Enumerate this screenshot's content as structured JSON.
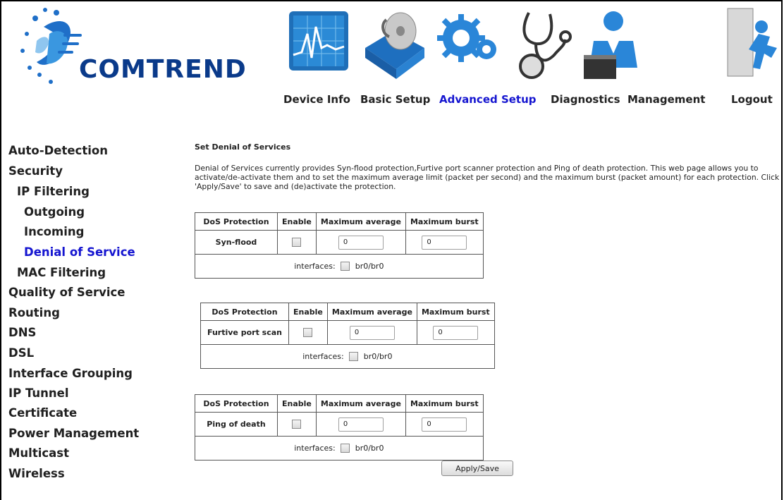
{
  "header": {
    "brand": "COMTREND",
    "nav": [
      {
        "label": "Device Info",
        "icon": "chart-icon"
      },
      {
        "label": "Basic Setup",
        "icon": "disc-icon"
      },
      {
        "label": "Advanced Setup",
        "icon": "gear-icon"
      },
      {
        "label": "Diagnostics",
        "icon": "stethoscope-icon"
      },
      {
        "label": "Management",
        "icon": "user-icon"
      },
      {
        "label": "Logout",
        "icon": "exit-icon"
      }
    ],
    "active_index": 2
  },
  "sidebar": {
    "items": [
      {
        "label": "Auto-Detection"
      },
      {
        "label": "Security"
      },
      {
        "label": "IP Filtering"
      },
      {
        "label": "Outgoing"
      },
      {
        "label": "Incoming"
      },
      {
        "label": "Denial of Service"
      },
      {
        "label": "MAC Filtering"
      },
      {
        "label": "Quality of Service"
      },
      {
        "label": "Routing"
      },
      {
        "label": "DNS"
      },
      {
        "label": "DSL"
      },
      {
        "label": "Interface Grouping"
      },
      {
        "label": "IP Tunnel"
      },
      {
        "label": "Certificate"
      },
      {
        "label": "Power Management"
      },
      {
        "label": "Multicast"
      },
      {
        "label": "Wireless"
      }
    ],
    "active_index": 5
  },
  "main": {
    "title": "Set Denial of Services",
    "description": "Denial of Services currently provides Syn-flood protection,Furtive port scanner protection and Ping of death protection. This web page allows you to activate/de-activate them and to set the maximum average limit (packet per second) and the maximum burst (packet amount) for each protection. Click 'Apply/Save' to save and (de)activate the protection.",
    "columns": {
      "protection": "DoS Protection",
      "enable": "Enable",
      "avg": "Maximum average",
      "burst": "Maximum burst"
    },
    "tables": [
      {
        "name": "Syn-flood",
        "enabled": false,
        "max_average": "0",
        "max_burst": "0",
        "interfaces_label": "interfaces:",
        "interface": "br0/br0"
      },
      {
        "name": "Furtive port scan",
        "enabled": false,
        "max_average": "0",
        "max_burst": "0",
        "interfaces_label": "interfaces:",
        "interface": "br0/br0"
      },
      {
        "name": "Ping of death",
        "enabled": false,
        "max_average": "0",
        "max_burst": "0",
        "interfaces_label": "interfaces:",
        "interface": "br0/br0"
      }
    ],
    "apply_label": "Apply/Save"
  },
  "colors": {
    "brand": "#0a3a8a",
    "active_link": "#1515d0",
    "icon_blue": "#1f7fd0"
  }
}
